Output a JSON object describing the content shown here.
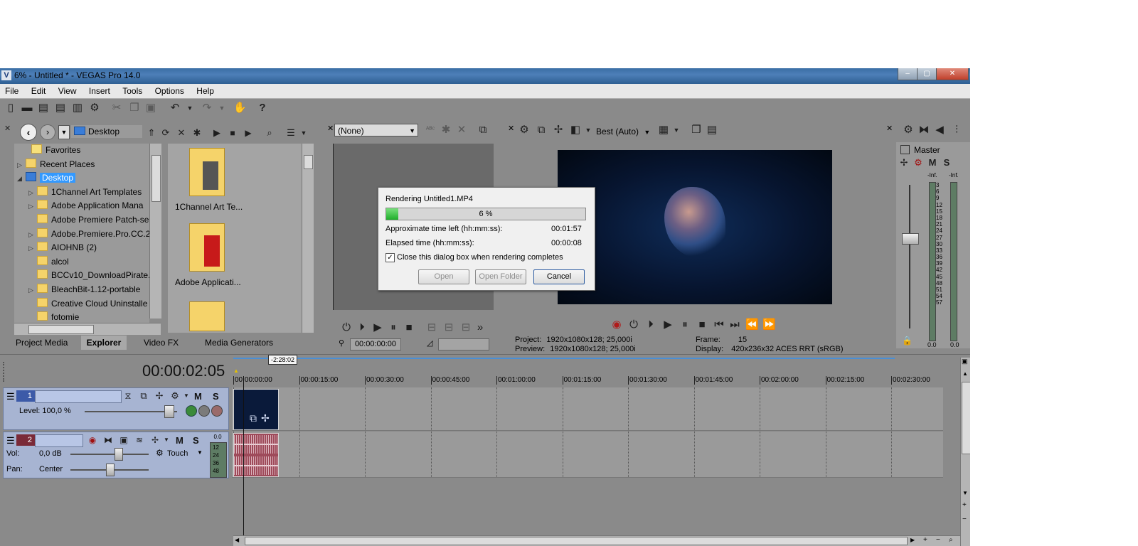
{
  "window": {
    "title": "6% - Untitled * - VEGAS Pro 14.0",
    "logo": "V",
    "minimize": "–",
    "maximize": "▢",
    "close": "✕"
  },
  "menu": [
    "File",
    "Edit",
    "View",
    "Insert",
    "Tools",
    "Options",
    "Help"
  ],
  "explorer": {
    "location": "Desktop",
    "tree": [
      {
        "label": "Favorites",
        "icon": "star-icon",
        "indent": 1,
        "expander": ""
      },
      {
        "label": "Recent Places",
        "icon": "folder-icon",
        "indent": 0,
        "expander": "▷"
      },
      {
        "label": "Desktop",
        "icon": "monitor-icon",
        "indent": 0,
        "expander": "◢",
        "selected": true
      },
      {
        "label": "1Channel Art Templates",
        "icon": "folder-icon",
        "indent": 2,
        "expander": "▷"
      },
      {
        "label": "Adobe Application Mana",
        "icon": "folder-icon",
        "indent": 2,
        "expander": "▷"
      },
      {
        "label": "Adobe Premiere Patch-se",
        "icon": "folder-icon",
        "indent": 2,
        "expander": ""
      },
      {
        "label": "Adobe.Premiere.Pro.CC.2",
        "icon": "folder-icon",
        "indent": 2,
        "expander": "▷"
      },
      {
        "label": "AIOHNB (2)",
        "icon": "folder-icon",
        "indent": 2,
        "expander": "▷"
      },
      {
        "label": "alcol",
        "icon": "folder-icon",
        "indent": 2,
        "expander": ""
      },
      {
        "label": "BCCv10_DownloadPirate.",
        "icon": "folder-icon",
        "indent": 2,
        "expander": ""
      },
      {
        "label": "BleachBit-1.12-portable",
        "icon": "folder-icon",
        "indent": 2,
        "expander": "▷"
      },
      {
        "label": "Creative Cloud Uninstalle",
        "icon": "folder-icon",
        "indent": 2,
        "expander": ""
      },
      {
        "label": "fotomie",
        "icon": "folder-icon",
        "indent": 2,
        "expander": ""
      }
    ],
    "thumbnails": [
      "1Channel Art Te...",
      "Adobe Applicati..."
    ],
    "tabs": [
      "Project Media",
      "Explorer",
      "Video FX",
      "Media Generators"
    ]
  },
  "trimmer": {
    "preset": "(None)",
    "timecode": "00:00:00:00"
  },
  "preview": {
    "quality": "Best (Auto)",
    "project_label": "Project:",
    "project_value": "1920x1080x128; 25,000i",
    "preview_label": "Preview:",
    "preview_value": "1920x1080x128; 25,000i",
    "frame_label": "Frame:",
    "frame_value": "15",
    "display_label": "Display:",
    "display_value": "420x236x32 ACES RRT (sRGB)"
  },
  "render_dialog": {
    "title": "Rendering Untitled1.MP4",
    "progress_text": "6 %",
    "progress": 0.06,
    "time_left_label": "Approximate time left (hh:mm:ss):",
    "time_left_value": "00:01:57",
    "elapsed_label": "Elapsed time (hh:mm:ss):",
    "elapsed_value": "00:00:08",
    "close_checkbox_label": "Close this dialog box when rendering completes",
    "close_checkbox_checked": true,
    "open_button": "Open",
    "open_folder_button": "Open Folder",
    "cancel_button": "Cancel"
  },
  "master": {
    "label": "Master",
    "left_inf": "-Inf.",
    "right_inf": "-Inf.",
    "scale": [
      "3",
      "6",
      "9",
      "12",
      "15",
      "18",
      "21",
      "24",
      "27",
      "30",
      "33",
      "36",
      "39",
      "42",
      "45",
      "48",
      "51",
      "54",
      "57"
    ],
    "left_value": "0.0",
    "right_value": "0.0"
  },
  "timeline": {
    "timecode": "00:00:02:05",
    "region_marker": "-2:28:02",
    "ruler": [
      "00:00:00:00",
      "00:00:15:00",
      "00:00:30:00",
      "00:00:45:00",
      "00:01:00:00",
      "00:01:15:00",
      "00:01:30:00",
      "00:01:45:00",
      "00:02:00:00",
      "00:02:15:00",
      "00:02:30:00"
    ],
    "video_track": {
      "number": "1",
      "level_label": "Level: 100,0 %",
      "level": 1.0
    },
    "audio_track": {
      "number": "2",
      "vol_label": "Vol:",
      "vol_value": "0,0 dB",
      "pan_label": "Pan:",
      "pan_value": "Center",
      "automation": "Touch",
      "meter_top": "0.0",
      "meter_scale": [
        "12",
        "24",
        "36",
        "48"
      ]
    }
  },
  "colors": {
    "accent_progress": "#2ecc40",
    "selection": "#3399ff",
    "audio_track_header": "#7a2a38",
    "video_track_header": "#3c5aa8",
    "audio_clip": "#9e4a5a"
  }
}
